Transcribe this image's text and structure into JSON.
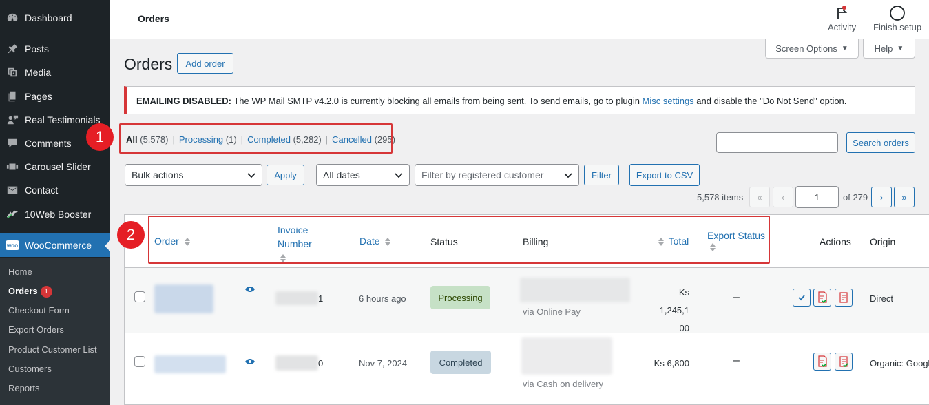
{
  "sidebar": {
    "items": [
      {
        "label": "Dashboard",
        "icon": "dashboard-icon"
      },
      {
        "label": "Posts",
        "icon": "pin-icon"
      },
      {
        "label": "Media",
        "icon": "media-icon"
      },
      {
        "label": "Pages",
        "icon": "pages-icon"
      },
      {
        "label": "Real Testimonials",
        "icon": "testimonials-icon"
      },
      {
        "label": "Comments",
        "icon": "comment-icon"
      },
      {
        "label": "Carousel Slider",
        "icon": "slider-icon"
      },
      {
        "label": "Contact",
        "icon": "envelope-icon"
      },
      {
        "label": "10Web Booster",
        "icon": "booster-icon"
      },
      {
        "label": "WooCommerce",
        "icon": "woo-icon"
      }
    ],
    "woo_logo_text": "woo",
    "submenu": [
      {
        "label": "Home"
      },
      {
        "label": "Orders",
        "badge": "1"
      },
      {
        "label": "Checkout Form"
      },
      {
        "label": "Export Orders"
      },
      {
        "label": "Product Customer List"
      },
      {
        "label": "Customers"
      },
      {
        "label": "Reports"
      }
    ]
  },
  "topbar": {
    "title": "Orders",
    "activity_label": "Activity",
    "finish_setup_label": "Finish setup"
  },
  "header": {
    "title": "Orders",
    "add_order_label": "Add order",
    "screen_options_label": "Screen Options",
    "help_label": "Help"
  },
  "notice": {
    "label": "EMAILING DISABLED:",
    "text_before": " The WP Mail SMTP v4.2.0 is currently blocking all emails from being sent. To send emails, go to plugin ",
    "link": "Misc settings",
    "text_after": " and disable the \"Do Not Send\" option."
  },
  "status_links": [
    {
      "label": "All",
      "count": "(5,578)"
    },
    {
      "label": "Processing",
      "count": "(1)"
    },
    {
      "label": "Completed",
      "count": "(5,282)"
    },
    {
      "label": "Cancelled",
      "count": "(295)"
    }
  ],
  "annotations": {
    "one": "1",
    "two": "2"
  },
  "search": {
    "value": "",
    "button_label": "Search orders"
  },
  "filters": {
    "bulk_actions": "Bulk actions",
    "apply_label": "Apply",
    "dates": "All dates",
    "customer_placeholder": "Filter by registered customer",
    "filter_label": "Filter",
    "export_csv_label": "Export to CSV"
  },
  "pagination": {
    "items": "5,578 items",
    "first": "«",
    "prev": "‹",
    "current_page": "1",
    "of_pages": "of 279",
    "next": "›",
    "last": "»"
  },
  "table": {
    "columns": {
      "order": "Order",
      "invoice_line1": "Invoice",
      "invoice_line2": "Number",
      "date": "Date",
      "status": "Status",
      "billing": "Billing",
      "total": "Total",
      "export_status": "Export Status",
      "actions": "Actions",
      "origin": "Origin"
    },
    "rows": [
      {
        "invoice_suffix": "1",
        "date": "6 hours ago",
        "status": "Processing",
        "billing_via": "via Online Pay",
        "total_line1": "Ks 1,245,1",
        "total_line2": "00",
        "export_status": "–",
        "origin": "Direct"
      },
      {
        "invoice_suffix": "0",
        "date": "Nov 7, 2024",
        "status": "Completed",
        "billing_via": "via Cash on delivery",
        "total_line1": "Ks 6,800",
        "export_status": "–",
        "origin": "Organic: Googl"
      }
    ]
  },
  "colors": {
    "sidebar_bg": "#1d2327",
    "accent": "#2271b1",
    "annotation_red": "#e51e25",
    "processing_bg": "#c6e1c6",
    "completed_bg": "#c8d7e1"
  }
}
